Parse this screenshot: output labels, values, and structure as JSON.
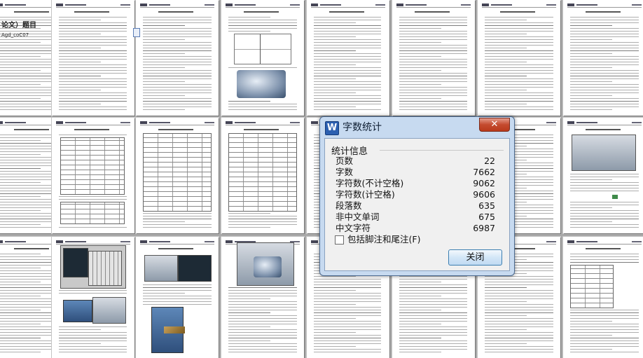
{
  "dialog": {
    "title": "字数统计",
    "app_icon_letter": "W",
    "close_glyph": "✕",
    "group_title": "统计信息",
    "stats": [
      {
        "label": "页数",
        "value": "22"
      },
      {
        "label": "字数",
        "value": "7662"
      },
      {
        "label": "字符数(不计空格)",
        "value": "9062"
      },
      {
        "label": "字符数(计空格)",
        "value": "9606"
      },
      {
        "label": "段落数",
        "value": "635"
      },
      {
        "label": "非中文单词",
        "value": "675"
      },
      {
        "label": "中文字符",
        "value": "6987"
      }
    ],
    "checkbox_label": "包括脚注和尾注(F)",
    "checkbox_checked": false,
    "close_button_label": "关闭"
  },
  "left_fragments": {
    "title_tail": "论文）题目",
    "subtitle": "Agd_coC07"
  },
  "icons": {
    "document_icon": "document-icon",
    "app_icon": "word-icon",
    "close_icon": "close-icon"
  },
  "colors": {
    "workspace": "#a9a9a9",
    "dialog_frame": "#c7daf0",
    "close_red": "#c44a2e"
  }
}
